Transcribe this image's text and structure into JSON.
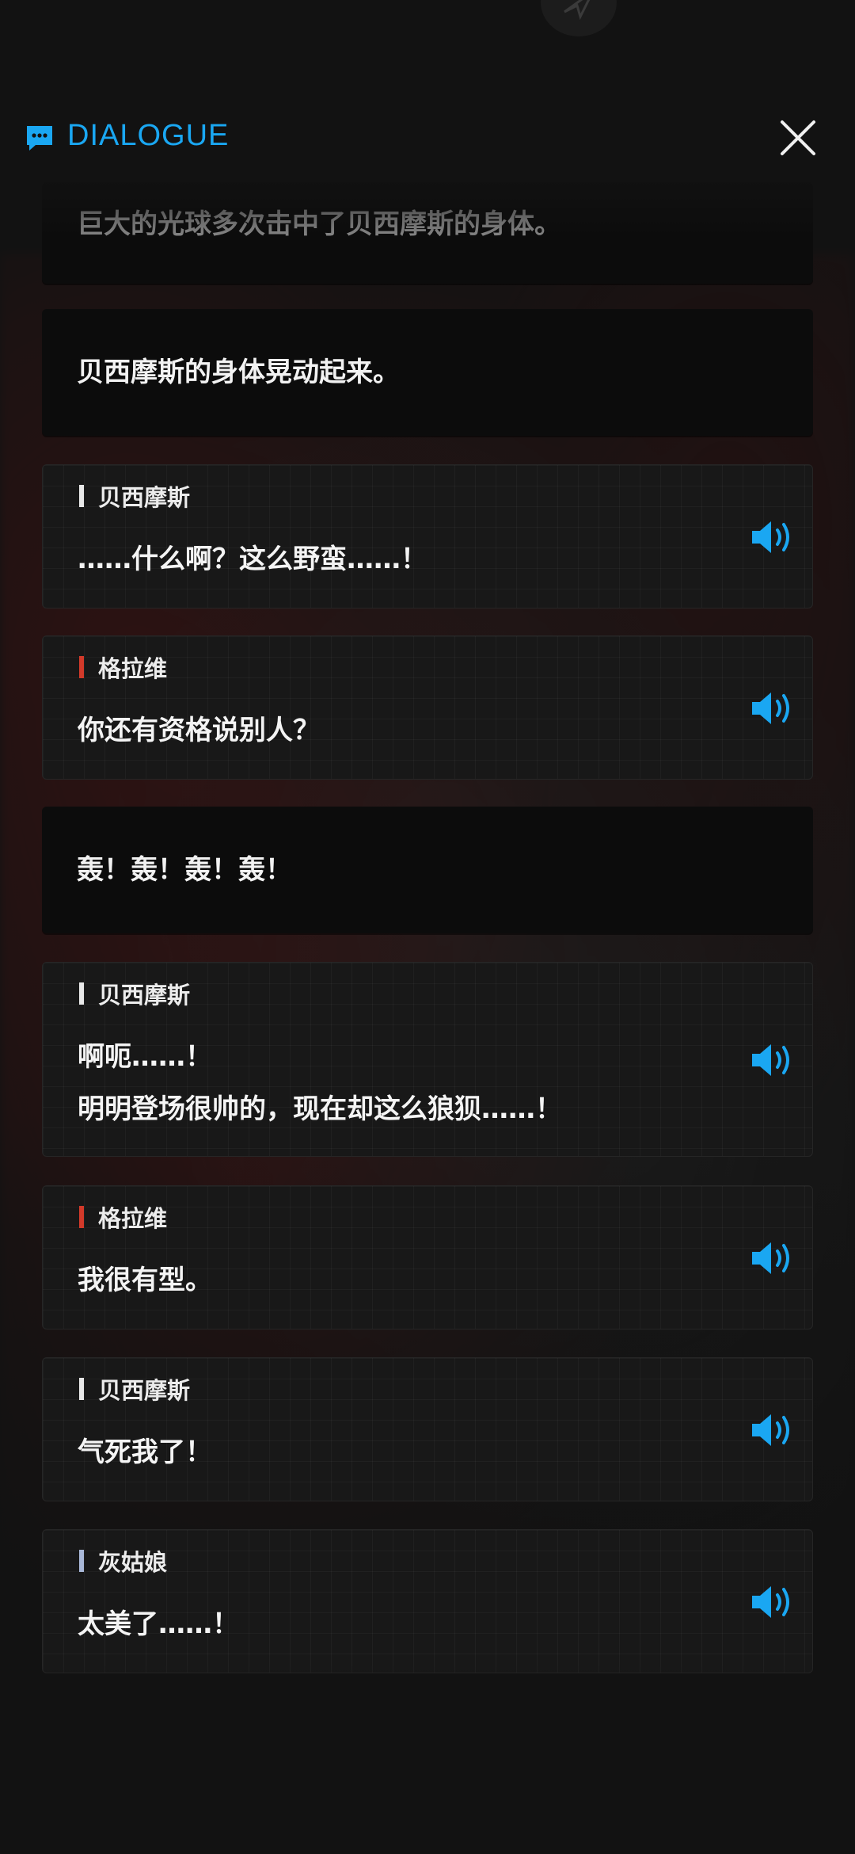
{
  "header": {
    "title": "DIALOGUE",
    "icon": "chat-bubble-icon",
    "close_icon": "close-icon"
  },
  "colors": {
    "accent": "#1aa7f2",
    "speaker_bessemer": "#e8e8e8",
    "speaker_gravel": "#d23a2a",
    "speaker_cinderella": "#a9b8d8"
  },
  "entries": [
    {
      "type": "narration",
      "text": "巨大的光球多次击中了贝西摩斯的身体。"
    },
    {
      "type": "narration",
      "text": "贝西摩斯的身体晃动起来。"
    },
    {
      "type": "speech",
      "speaker": "贝西摩斯",
      "lines": [
        "……什么啊？这么野蛮……！"
      ],
      "voice_icon": "speaker-icon"
    },
    {
      "type": "speech",
      "speaker": "格拉维",
      "lines": [
        "你还有资格说别人？"
      ],
      "voice_icon": "speaker-icon"
    },
    {
      "type": "narration",
      "text": "轰！轰！轰！轰！"
    },
    {
      "type": "speech",
      "speaker": "贝西摩斯",
      "lines": [
        "啊呃……！",
        "明明登场很帅的，现在却这么狼狈……！"
      ],
      "voice_icon": "speaker-icon"
    },
    {
      "type": "speech",
      "speaker": "格拉维",
      "lines": [
        "我很有型。"
      ],
      "voice_icon": "speaker-icon"
    },
    {
      "type": "speech",
      "speaker": "贝西摩斯",
      "lines": [
        "气死我了！"
      ],
      "voice_icon": "speaker-icon"
    },
    {
      "type": "speech",
      "speaker": "灰姑娘",
      "lines": [
        "太美了……！"
      ],
      "voice_icon": "speaker-icon"
    }
  ]
}
